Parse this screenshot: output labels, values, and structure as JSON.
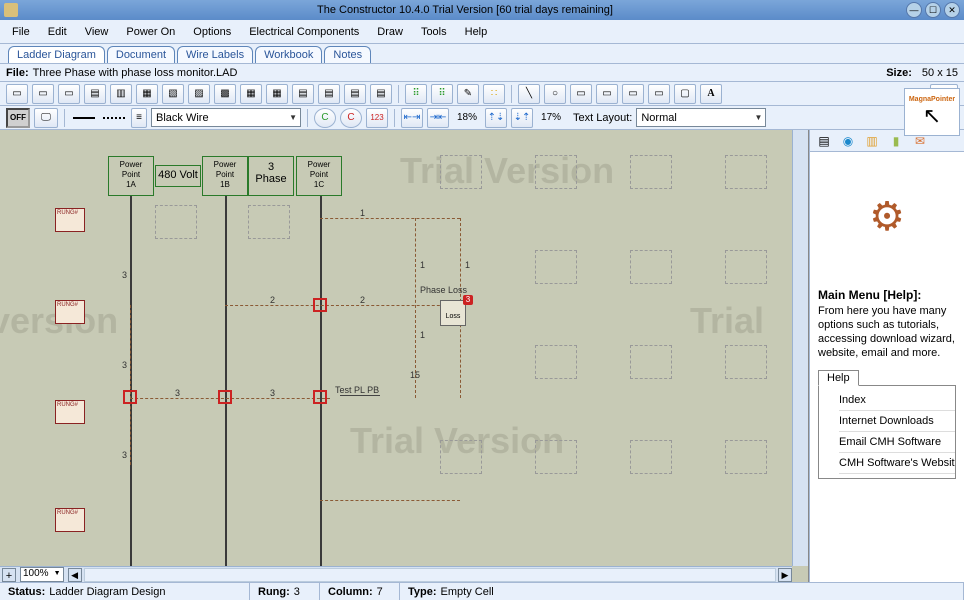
{
  "title": "The Constructor 10.4.0 Trial Version   [60 trial days remaining]",
  "menubar": [
    "File",
    "Edit",
    "View",
    "Power On",
    "Options",
    "Electrical Components",
    "Draw",
    "Tools",
    "Help"
  ],
  "tabs": [
    "Ladder Diagram",
    "Document",
    "Wire Labels",
    "Workbook",
    "Notes"
  ],
  "filebar": {
    "label": "File:",
    "name": "Three Phase with phase loss monitor.LAD",
    "size_label": "Size:",
    "size": "50 x 15"
  },
  "toolbar2": {
    "off": "OFF",
    "wire_dd": "Black Wire",
    "c1_label": "C",
    "c2_label": "C",
    "num123": "123",
    "pct1": "18%",
    "pct2": "17%",
    "text_layout_label": "Text Layout:",
    "text_layout": "Normal"
  },
  "magna": "MagnaPointer",
  "canvas": {
    "watermark1": "Trial Version",
    "watermark2": "version",
    "watermark3": "Trial",
    "watermark4": "Trial Version",
    "power_1a": "Power\nPoint\n1A",
    "power_1b": "Power\nPoint\n1B",
    "power_1c": "Power\nPoint\n1C",
    "volt": "480 Volt",
    "phase": "3\nPhase",
    "phase_loss": "Phase Loss",
    "loss_box": "Loss",
    "loss_num": "3",
    "test_pl_pb": "Test PL PB",
    "num15": "15",
    "rung_label": "RUNG#",
    "n1": "1",
    "n2": "2",
    "n3": "3"
  },
  "zoombar": {
    "zoom": "100%",
    "small_plus": "+",
    "small_left": "◀",
    "small_right": "▶"
  },
  "rightpanel": {
    "heading": "Main Menu [Help]:",
    "body": "From here you have many options such as tutorials, accessing download wizard, website, email and more.",
    "help_tab": "Help",
    "items": [
      "Index",
      "Internet Downloads",
      "Email CMH Software",
      "CMH Software's Website"
    ]
  },
  "status": {
    "status_label": "Status:",
    "status": "Ladder Diagram Design",
    "rung_label": "Rung:",
    "rung": "3",
    "col_label": "Column:",
    "col": "7",
    "type_label": "Type:",
    "type": "Empty Cell"
  }
}
